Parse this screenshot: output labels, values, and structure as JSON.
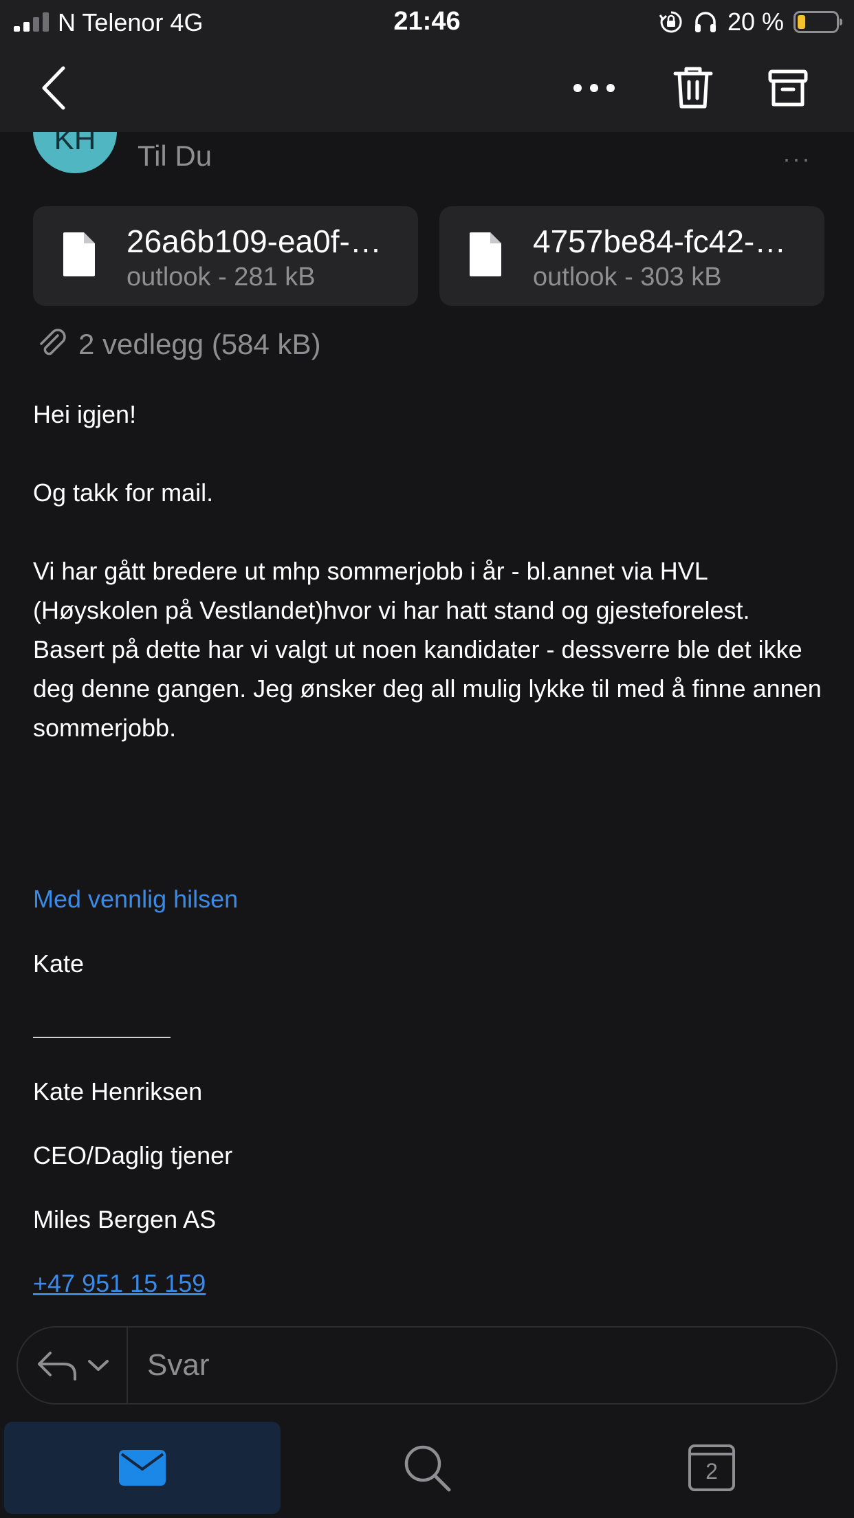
{
  "status_bar": {
    "carrier": "N Telenor   4G",
    "time": "21:46",
    "battery_percent": "20 %",
    "battery_level": 0.2,
    "icons": [
      "signal-icon",
      "rotation-lock-icon",
      "headphones-icon",
      "battery-icon"
    ]
  },
  "nav": {
    "icons": [
      "back-chevron-icon",
      "more-icon",
      "trash-icon",
      "archive-icon"
    ]
  },
  "header": {
    "avatar_initials": "KH",
    "to_line": "Til Du",
    "more": "···"
  },
  "attachments": {
    "files": [
      {
        "name": "26a6b109-ea0f-…",
        "meta": "outlook - 281 kB"
      },
      {
        "name": "4757be84-fc42-…",
        "meta": "outlook - 303 kB"
      }
    ],
    "summary": "2 vedlegg (584 kB)"
  },
  "body": {
    "greeting": "Hei igjen!",
    "thanks": "Og takk for mail.",
    "paragraph": "Vi har gått bredere ut mhp sommerjobb i år - bl.annet via HVL (Høyskolen på Vestlandet)hvor vi har hatt stand og gjesteforelest. Basert på dette har vi valgt ut noen kandidater - dessverre ble det ikke deg denne gangen. Jeg ønsker deg all mulig lykke til med å finne annen sommerjobb.",
    "closing": "Med vennlig hilsen",
    "sign_name": "Kate"
  },
  "signature": {
    "full_name": "Kate Henriksen",
    "title": "CEO/Daglig tjener",
    "company": "Miles Bergen AS",
    "phone": "+47 951 15 159"
  },
  "reply": {
    "placeholder": "Svar"
  },
  "tab_bar": {
    "calendar_day": "2",
    "active_tab": "mail"
  },
  "colors": {
    "background": "#151517",
    "accent_blue": "#3a8ae6",
    "avatar": "#4fb6c2",
    "battery_low": "#f2c230"
  }
}
